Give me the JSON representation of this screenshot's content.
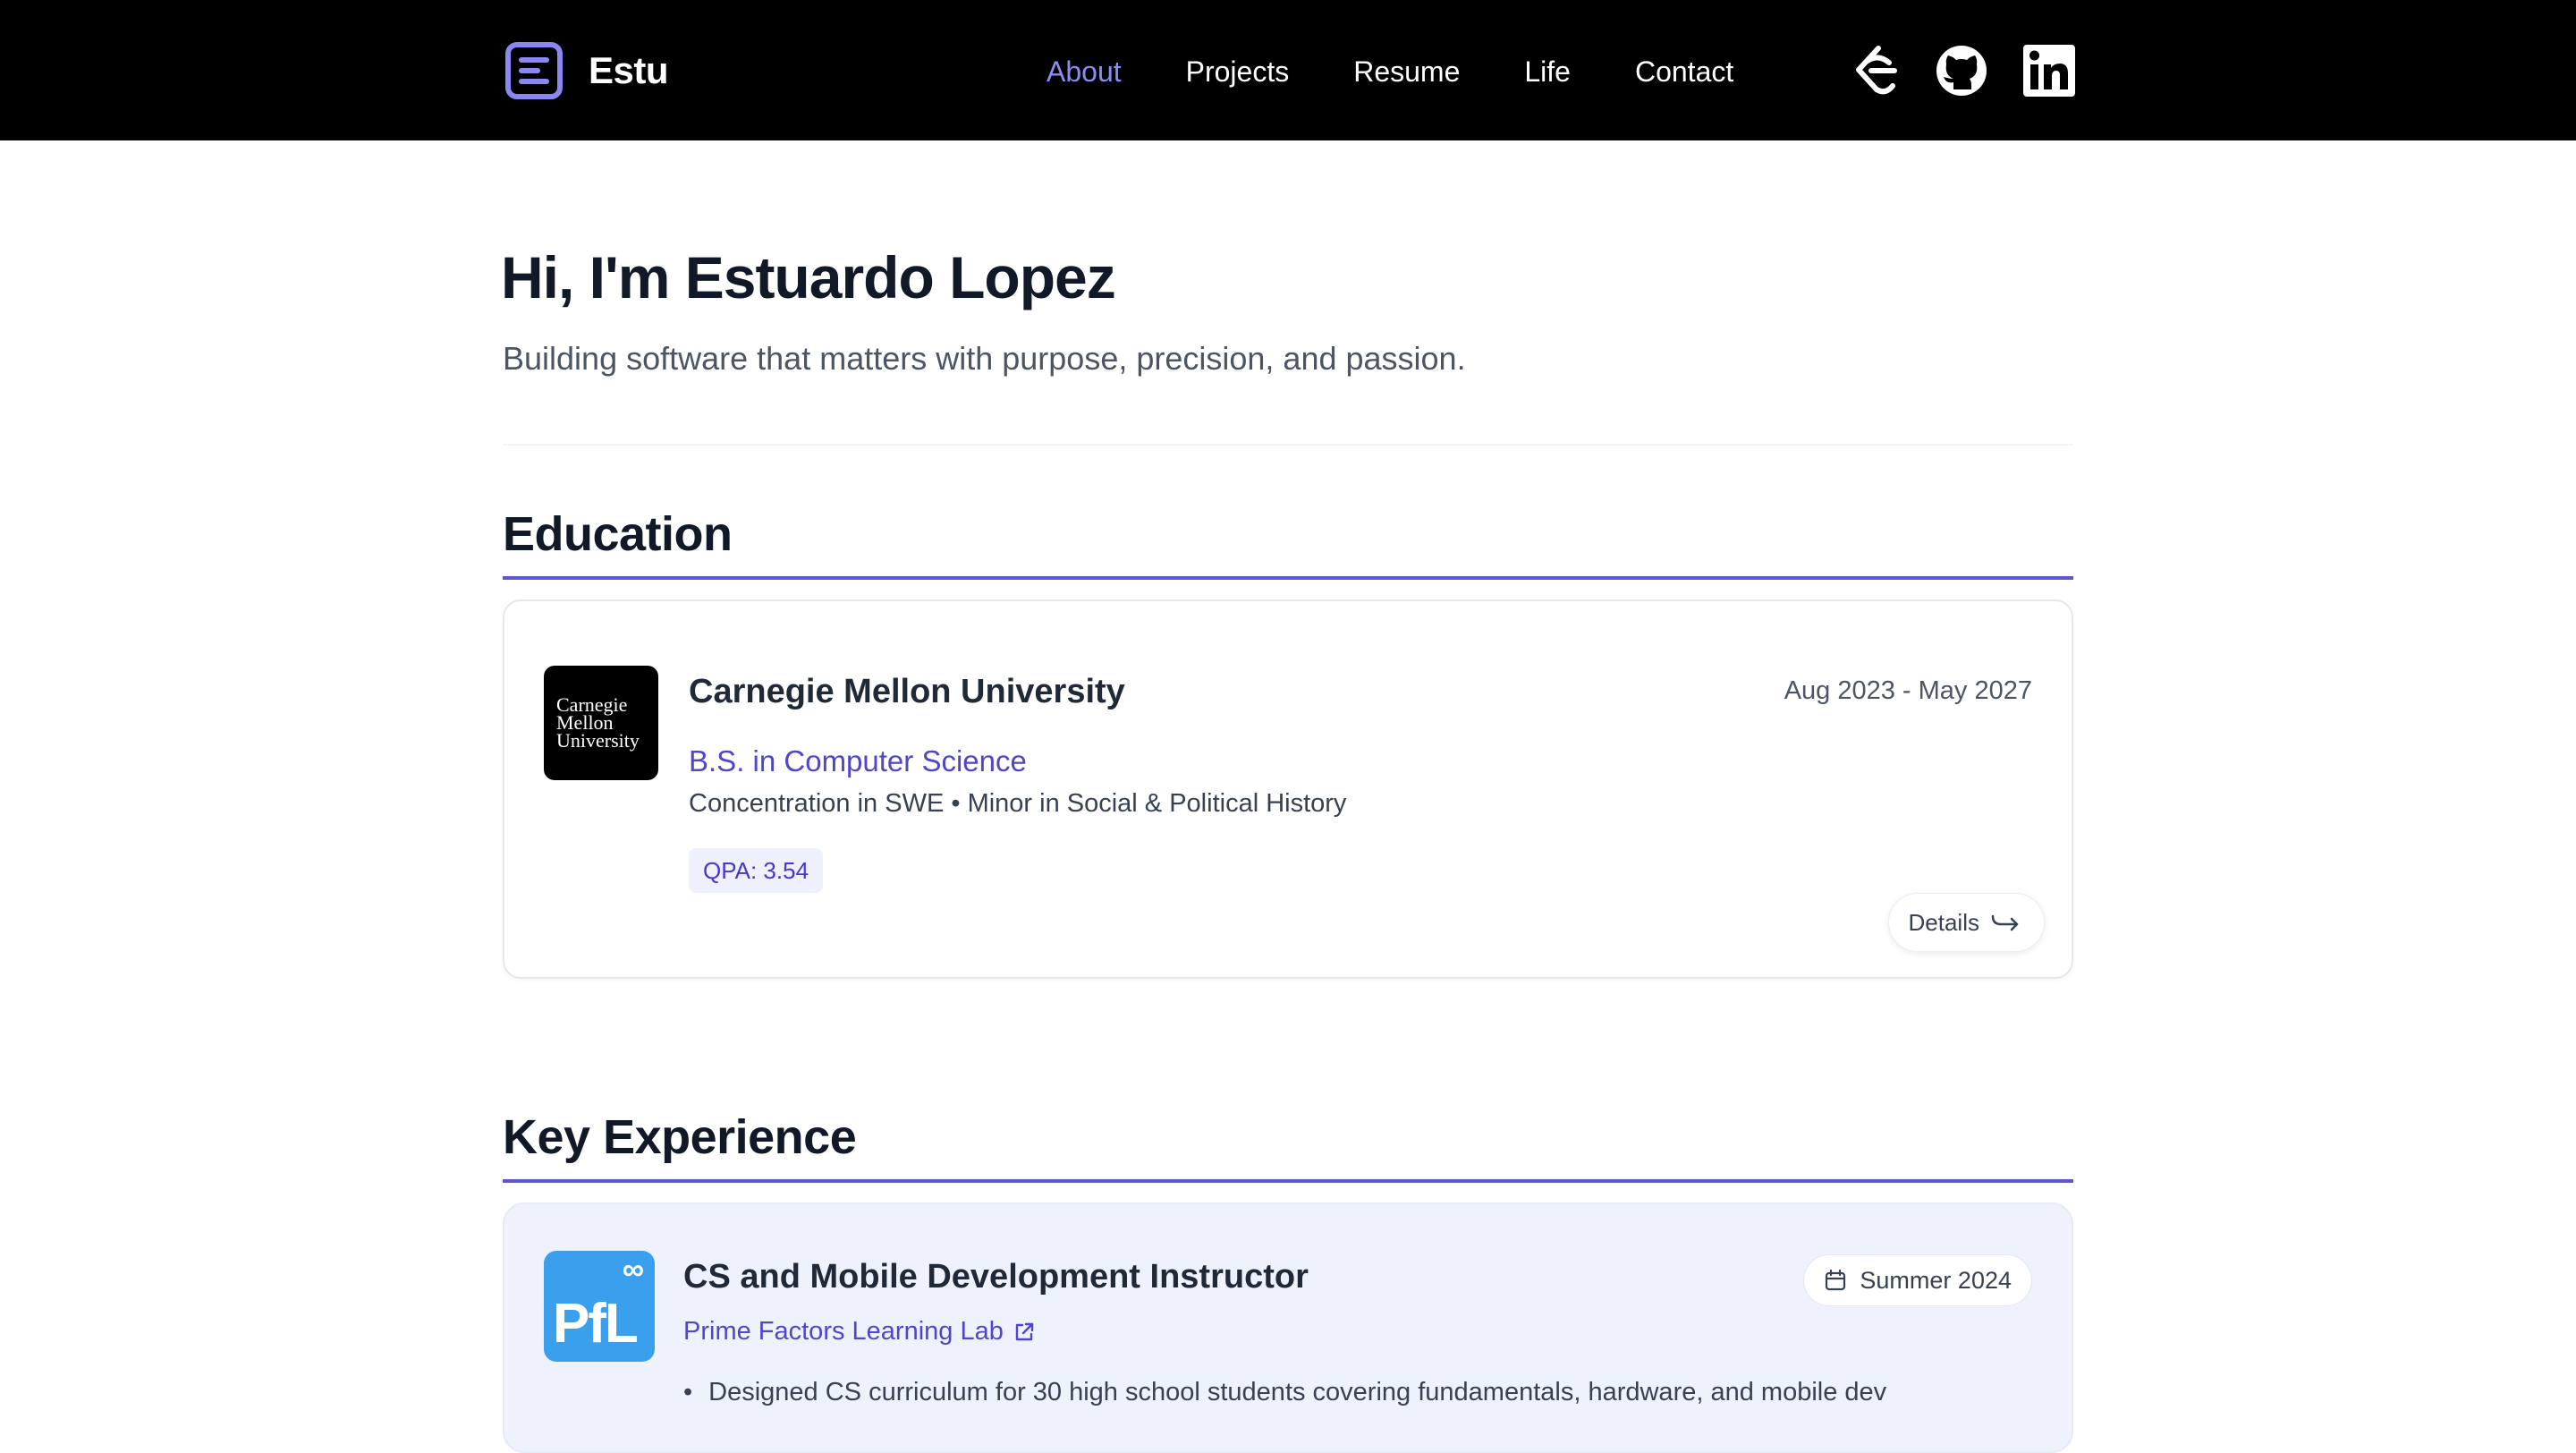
{
  "brand": {
    "name": "Estu"
  },
  "nav": {
    "items": [
      {
        "label": "About",
        "active": true
      },
      {
        "label": "Projects",
        "active": false
      },
      {
        "label": "Resume",
        "active": false
      },
      {
        "label": "Life",
        "active": false
      },
      {
        "label": "Contact",
        "active": false
      }
    ],
    "social_icons": [
      "leetcode-icon",
      "github-icon",
      "linkedin-icon"
    ]
  },
  "hero": {
    "title": "Hi, I'm Estuardo Lopez",
    "subtitle": "Building software that matters with purpose, precision, and passion."
  },
  "education": {
    "heading": "Education",
    "entry": {
      "logo_lines": [
        "Carnegie",
        "Mellon",
        "University"
      ],
      "school": "Carnegie Mellon University",
      "dates": "Aug 2023 - May 2027",
      "degree": "B.S. in Computer Science",
      "concentration": "Concentration in SWE • Minor in Social & Political History",
      "badge": "QPA: 3.54",
      "details_label": "Details"
    }
  },
  "experience": {
    "heading": "Key Experience",
    "entry": {
      "logo_symbol": "∞",
      "logo_text": "PfL",
      "title": "CS and Mobile Development Instructor",
      "company": "Prime Factors Learning Lab",
      "period": "Summer 2024",
      "bullet": "Designed CS curriculum for 30 high school students covering fundamentals, hardware, and mobile dev"
    }
  },
  "colors": {
    "navbar_bg": "#000000",
    "accent": "#5b56d6",
    "active_nav": "#8b8bf0",
    "link": "#4f46c8",
    "experience_card_bg": "#eef2fc",
    "pfl_logo_bg": "#3aa0ee"
  }
}
